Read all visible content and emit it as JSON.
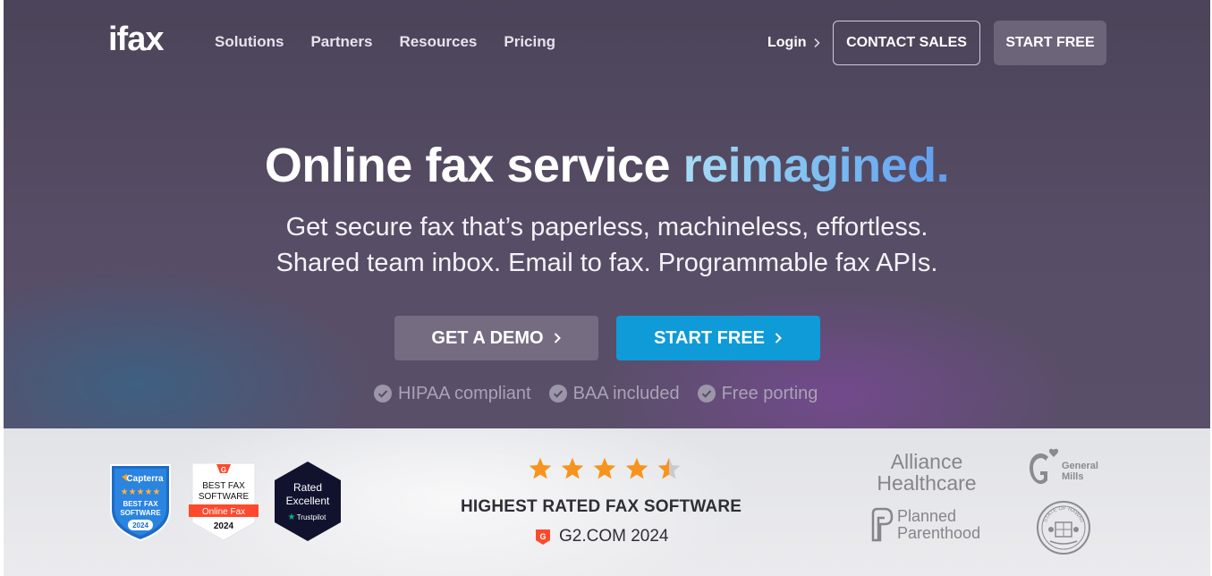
{
  "brand": {
    "logo_text": "ifax"
  },
  "nav": {
    "links": [
      "Solutions",
      "Partners",
      "Resources",
      "Pricing"
    ],
    "login": "Login",
    "contact_sales": "CONTACT SALES",
    "start_free": "START FREE"
  },
  "hero": {
    "headline_main": "Online fax service",
    "headline_accent": "reimagined.",
    "subline_1": "Get secure fax that’s paperless, machineless, effortless.",
    "subline_2": "Shared team inbox. Email to fax. Programmable fax APIs.",
    "demo_button": "GET A DEMO",
    "free_button": "START FREE",
    "features": [
      "HIPAA compliant",
      "BAA included",
      "Free porting"
    ]
  },
  "social_proof": {
    "rating_stars": 4.5,
    "rating_max": 5,
    "headline": "HIGHEST RATED FAX SOFTWARE",
    "source": "G2.COM 2024",
    "badges": {
      "capterra": {
        "brand": "Capterra",
        "line1": "BEST FAX",
        "line2": "SOFTWARE",
        "year": "2024"
      },
      "g2": {
        "line1": "BEST FAX",
        "line2": "SOFTWARE",
        "ribbon": "Online Fax",
        "year": "2024"
      },
      "trustpilot": {
        "line1": "Rated",
        "line2": "Excellent",
        "brand": "Trustpilot"
      }
    },
    "customer_logos": {
      "alliance": [
        "Alliance",
        "Healthcare"
      ],
      "general_mills": [
        "General",
        "Mills"
      ],
      "planned_parenthood": [
        "Planned",
        "Parenthood"
      ],
      "seal": "STATE OF HAWAII"
    }
  },
  "colors": {
    "hero_bg": "#524a62",
    "primary_button": "#0f9ad8",
    "secondary_button": "#756c82",
    "star": "#f7941d",
    "strip_bg": "#e6e6ea"
  }
}
